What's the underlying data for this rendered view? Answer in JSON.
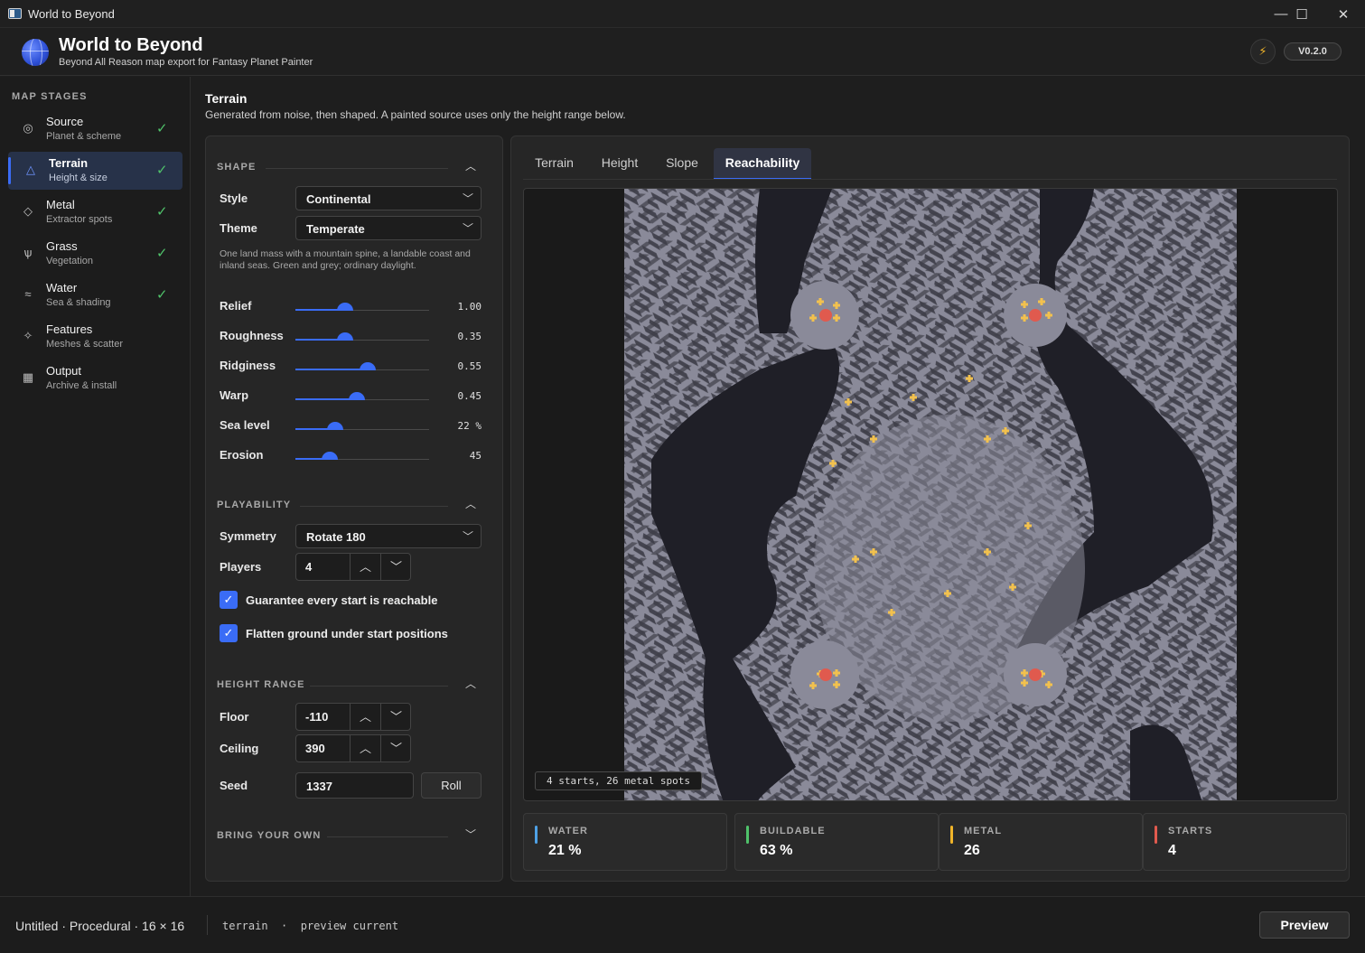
{
  "window": {
    "title": "World to Beyond",
    "minimize_icon": "minimize-icon",
    "maximize_icon": "maximize-icon",
    "close_icon": "close-icon"
  },
  "header": {
    "app_name": "World to Beyond",
    "subtitle": "Beyond All Reason map export for Fantasy Planet Painter",
    "version": "V0.2.0",
    "bolt_icon": "lightning-icon",
    "logo_icon": "globe-icon"
  },
  "sidebar": {
    "title": "MAP STAGES",
    "items": [
      {
        "label": "Source",
        "sub": "Planet & scheme",
        "icon": "target-icon",
        "done": true
      },
      {
        "label": "Terrain",
        "sub": "Height & size",
        "icon": "triangle-icon",
        "done": true,
        "active": true
      },
      {
        "label": "Metal",
        "sub": "Extractor spots",
        "icon": "diamond-icon",
        "done": true
      },
      {
        "label": "Grass",
        "sub": "Vegetation",
        "icon": "sprout-icon",
        "done": true
      },
      {
        "label": "Water",
        "sub": "Sea & shading",
        "icon": "waves-icon",
        "done": true
      },
      {
        "label": "Features",
        "sub": "Meshes & scatter",
        "icon": "sparkle-icon",
        "done": false
      },
      {
        "label": "Output",
        "sub": "Archive & install",
        "icon": "grid-icon",
        "done": false
      }
    ]
  },
  "page": {
    "title": "Terrain",
    "subtitle": "Generated from noise, then shaped. A painted source uses only the height range below."
  },
  "shape": {
    "title": "SHAPE",
    "style_label": "Style",
    "style_value": "Continental",
    "theme_label": "Theme",
    "theme_value": "Temperate",
    "description": "One land mass with a mountain spine, a landable coast and inland seas. Green and grey; ordinary daylight.",
    "sliders": [
      {
        "label": "Relief",
        "value": "1.00",
        "fraction": 0.37
      },
      {
        "label": "Roughness",
        "value": "0.35",
        "fraction": 0.37
      },
      {
        "label": "Ridginess",
        "value": "0.55",
        "fraction": 0.54
      },
      {
        "label": "Warp",
        "value": "0.45",
        "fraction": 0.46
      },
      {
        "label": "Sea level",
        "value": "22 %",
        "fraction": 0.3
      },
      {
        "label": "Erosion",
        "value": "45",
        "fraction": 0.26
      }
    ]
  },
  "playability": {
    "title": "PLAYABILITY",
    "symmetry_label": "Symmetry",
    "symmetry_value": "Rotate 180",
    "players_label": "Players",
    "players_value": "4",
    "check1": "Guarantee every start is reachable",
    "check2": "Flatten ground under start positions"
  },
  "height_range": {
    "title": "HEIGHT RANGE",
    "floor_label": "Floor",
    "floor_value": "-110",
    "ceiling_label": "Ceiling",
    "ceiling_value": "390",
    "seed_label": "Seed",
    "seed_value": "1337",
    "roll_label": "Roll"
  },
  "byo": {
    "title": "BRING YOUR OWN"
  },
  "tabs": [
    "Terrain",
    "Height",
    "Slope",
    "Reachability"
  ],
  "map": {
    "badge": "4 starts, 26 metal spots"
  },
  "stats": [
    {
      "label": "WATER",
      "value": "21 %",
      "color": "#4ea1e6"
    },
    {
      "label": "BUILDABLE",
      "value": "63 %",
      "color": "#4fc26a"
    },
    {
      "label": "METAL",
      "value": "26",
      "color": "#f0b429"
    },
    {
      "label": "STARTS",
      "value": "4",
      "color": "#e05a4e"
    }
  ],
  "status": {
    "left": "Untitled · Procedural · 16 × 16",
    "mono": "terrain  ·  preview current",
    "preview_label": "Preview"
  },
  "colors": {
    "accent": "#3a6cf6",
    "land": "#8a8a99",
    "slope": "#3c3c46",
    "water": "#1f1f27",
    "metal": "#f2c14e",
    "start": "#e05a4e"
  }
}
